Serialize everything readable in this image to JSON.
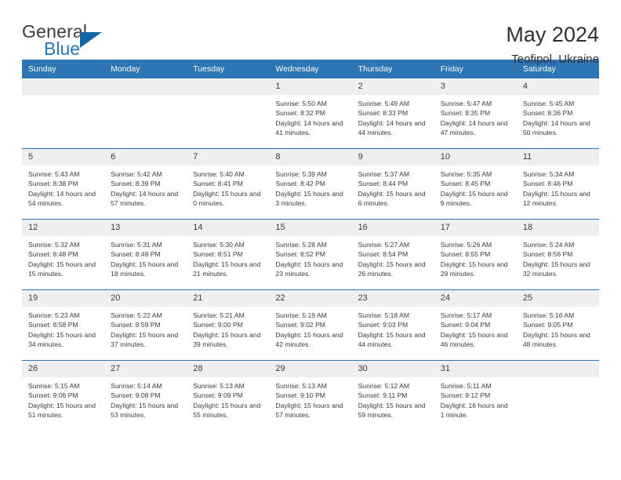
{
  "brand": {
    "name_part1": "General",
    "name_part2": "Blue",
    "logo_icon": "triangle-flag-icon"
  },
  "header": {
    "title": "May 2024",
    "subtitle": "Teofipol, Ukraine"
  },
  "calendar": {
    "weekday_headers": [
      "Sunday",
      "Monday",
      "Tuesday",
      "Wednesday",
      "Thursday",
      "Friday",
      "Saturday"
    ],
    "accent_color": "#2e75b6",
    "daynum_band_color": "#efefef",
    "weeks": [
      [
        {
          "day": "",
          "empty": true
        },
        {
          "day": "",
          "empty": true
        },
        {
          "day": "",
          "empty": true
        },
        {
          "day": "1",
          "sunrise": "Sunrise: 5:50 AM",
          "sunset": "Sunset: 8:32 PM",
          "daylight": "Daylight: 14 hours and 41 minutes."
        },
        {
          "day": "2",
          "sunrise": "Sunrise: 5:49 AM",
          "sunset": "Sunset: 8:33 PM",
          "daylight": "Daylight: 14 hours and 44 minutes."
        },
        {
          "day": "3",
          "sunrise": "Sunrise: 5:47 AM",
          "sunset": "Sunset: 8:35 PM",
          "daylight": "Daylight: 14 hours and 47 minutes."
        },
        {
          "day": "4",
          "sunrise": "Sunrise: 5:45 AM",
          "sunset": "Sunset: 8:36 PM",
          "daylight": "Daylight: 14 hours and 50 minutes."
        }
      ],
      [
        {
          "day": "5",
          "sunrise": "Sunrise: 5:43 AM",
          "sunset": "Sunset: 8:38 PM",
          "daylight": "Daylight: 14 hours and 54 minutes."
        },
        {
          "day": "6",
          "sunrise": "Sunrise: 5:42 AM",
          "sunset": "Sunset: 8:39 PM",
          "daylight": "Daylight: 14 hours and 57 minutes."
        },
        {
          "day": "7",
          "sunrise": "Sunrise: 5:40 AM",
          "sunset": "Sunset: 8:41 PM",
          "daylight": "Daylight: 15 hours and 0 minutes."
        },
        {
          "day": "8",
          "sunrise": "Sunrise: 5:39 AM",
          "sunset": "Sunset: 8:42 PM",
          "daylight": "Daylight: 15 hours and 3 minutes."
        },
        {
          "day": "9",
          "sunrise": "Sunrise: 5:37 AM",
          "sunset": "Sunset: 8:44 PM",
          "daylight": "Daylight: 15 hours and 6 minutes."
        },
        {
          "day": "10",
          "sunrise": "Sunrise: 5:35 AM",
          "sunset": "Sunset: 8:45 PM",
          "daylight": "Daylight: 15 hours and 9 minutes."
        },
        {
          "day": "11",
          "sunrise": "Sunrise: 5:34 AM",
          "sunset": "Sunset: 8:46 PM",
          "daylight": "Daylight: 15 hours and 12 minutes."
        }
      ],
      [
        {
          "day": "12",
          "sunrise": "Sunrise: 5:32 AM",
          "sunset": "Sunset: 8:48 PM",
          "daylight": "Daylight: 15 hours and 15 minutes."
        },
        {
          "day": "13",
          "sunrise": "Sunrise: 5:31 AM",
          "sunset": "Sunset: 8:49 PM",
          "daylight": "Daylight: 15 hours and 18 minutes."
        },
        {
          "day": "14",
          "sunrise": "Sunrise: 5:30 AM",
          "sunset": "Sunset: 8:51 PM",
          "daylight": "Daylight: 15 hours and 21 minutes."
        },
        {
          "day": "15",
          "sunrise": "Sunrise: 5:28 AM",
          "sunset": "Sunset: 8:52 PM",
          "daylight": "Daylight: 15 hours and 23 minutes."
        },
        {
          "day": "16",
          "sunrise": "Sunrise: 5:27 AM",
          "sunset": "Sunset: 8:54 PM",
          "daylight": "Daylight: 15 hours and 26 minutes."
        },
        {
          "day": "17",
          "sunrise": "Sunrise: 5:26 AM",
          "sunset": "Sunset: 8:55 PM",
          "daylight": "Daylight: 15 hours and 29 minutes."
        },
        {
          "day": "18",
          "sunrise": "Sunrise: 5:24 AM",
          "sunset": "Sunset: 8:56 PM",
          "daylight": "Daylight: 15 hours and 32 minutes."
        }
      ],
      [
        {
          "day": "19",
          "sunrise": "Sunrise: 5:23 AM",
          "sunset": "Sunset: 8:58 PM",
          "daylight": "Daylight: 15 hours and 34 minutes."
        },
        {
          "day": "20",
          "sunrise": "Sunrise: 5:22 AM",
          "sunset": "Sunset: 8:59 PM",
          "daylight": "Daylight: 15 hours and 37 minutes."
        },
        {
          "day": "21",
          "sunrise": "Sunrise: 5:21 AM",
          "sunset": "Sunset: 9:00 PM",
          "daylight": "Daylight: 15 hours and 39 minutes."
        },
        {
          "day": "22",
          "sunrise": "Sunrise: 5:19 AM",
          "sunset": "Sunset: 9:02 PM",
          "daylight": "Daylight: 15 hours and 42 minutes."
        },
        {
          "day": "23",
          "sunrise": "Sunrise: 5:18 AM",
          "sunset": "Sunset: 9:03 PM",
          "daylight": "Daylight: 15 hours and 44 minutes."
        },
        {
          "day": "24",
          "sunrise": "Sunrise: 5:17 AM",
          "sunset": "Sunset: 9:04 PM",
          "daylight": "Daylight: 15 hours and 46 minutes."
        },
        {
          "day": "25",
          "sunrise": "Sunrise: 5:16 AM",
          "sunset": "Sunset: 9:05 PM",
          "daylight": "Daylight: 15 hours and 48 minutes."
        }
      ],
      [
        {
          "day": "26",
          "sunrise": "Sunrise: 5:15 AM",
          "sunset": "Sunset: 9:06 PM",
          "daylight": "Daylight: 15 hours and 51 minutes."
        },
        {
          "day": "27",
          "sunrise": "Sunrise: 5:14 AM",
          "sunset": "Sunset: 9:08 PM",
          "daylight": "Daylight: 15 hours and 53 minutes."
        },
        {
          "day": "28",
          "sunrise": "Sunrise: 5:13 AM",
          "sunset": "Sunset: 9:09 PM",
          "daylight": "Daylight: 15 hours and 55 minutes."
        },
        {
          "day": "29",
          "sunrise": "Sunrise: 5:13 AM",
          "sunset": "Sunset: 9:10 PM",
          "daylight": "Daylight: 15 hours and 57 minutes."
        },
        {
          "day": "30",
          "sunrise": "Sunrise: 5:12 AM",
          "sunset": "Sunset: 9:11 PM",
          "daylight": "Daylight: 15 hours and 59 minutes."
        },
        {
          "day": "31",
          "sunrise": "Sunrise: 5:11 AM",
          "sunset": "Sunset: 9:12 PM",
          "daylight": "Daylight: 16 hours and 1 minute."
        },
        {
          "day": "",
          "empty": true
        }
      ]
    ]
  }
}
